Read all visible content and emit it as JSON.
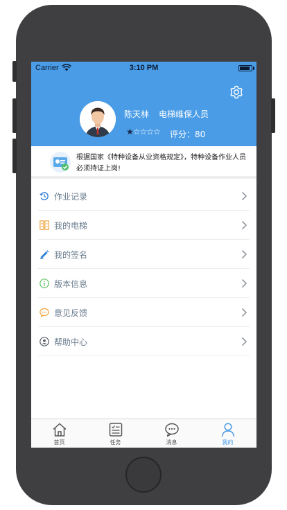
{
  "status_bar": {
    "carrier": "Carrier",
    "time": "3:10 PM"
  },
  "profile": {
    "name": "陈天林",
    "role": "电梯维保人员",
    "stars_filled": "★",
    "stars_empty": "☆☆☆☆",
    "rating_label": "评分：80",
    "rating_value": 1,
    "rating_max": 5
  },
  "notice": {
    "text": "根据国家《特种设备从业资格规定》，特种设备作业人员必须持证上岗!"
  },
  "menu": {
    "items": [
      {
        "label": "作业记录",
        "icon": "history-icon"
      },
      {
        "label": "我的电梯",
        "icon": "elevator-icon"
      },
      {
        "label": "我的签名",
        "icon": "pen-icon"
      },
      {
        "label": "版本信息",
        "icon": "info-icon"
      },
      {
        "label": "意见反馈",
        "icon": "feedback-icon"
      },
      {
        "label": "帮助中心",
        "icon": "help-icon"
      }
    ]
  },
  "tabs": [
    {
      "label": "首页",
      "icon": "home-icon"
    },
    {
      "label": "任务",
      "icon": "task-icon"
    },
    {
      "label": "消息",
      "icon": "message-icon"
    },
    {
      "label": "我的",
      "icon": "profile-icon",
      "active": true
    }
  ],
  "colors": {
    "header_blue": "#4a9ce6",
    "accent_orange": "#f0a43a",
    "info_green": "#5cc05c",
    "icon_blue": "#2f7fd6"
  }
}
